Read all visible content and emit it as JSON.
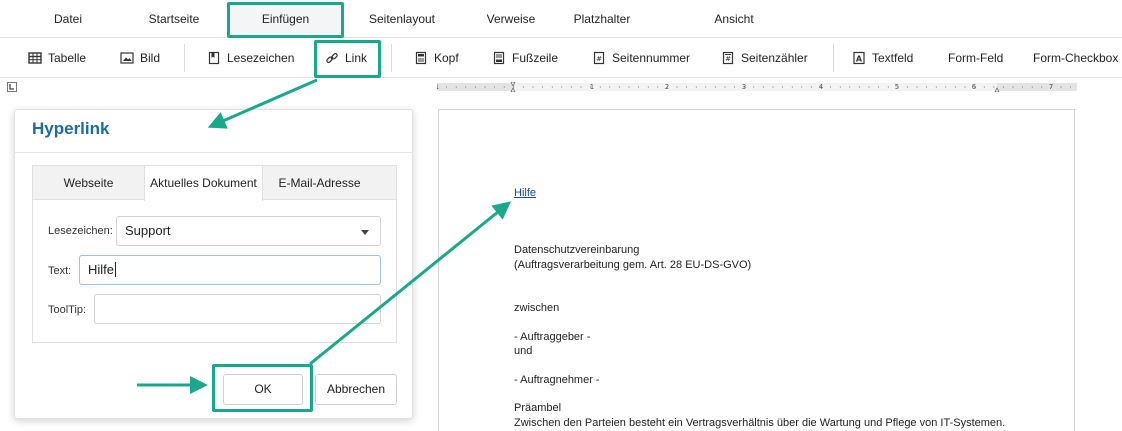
{
  "ribbon": {
    "tabs": [
      {
        "label": "Datei"
      },
      {
        "label": "Startseite"
      },
      {
        "label": "Einfügen"
      },
      {
        "label": "Seitenlayout"
      },
      {
        "label": "Verweise"
      },
      {
        "label": "Platzhalter"
      },
      {
        "label": "Ansicht"
      }
    ],
    "active_tab": "Einfügen"
  },
  "toolbar": {
    "table_label": "Tabelle",
    "image_label": "Bild",
    "bookmark_label": "Lesezeichen",
    "link_label": "Link",
    "header_label": "Kopf",
    "footer_label": "Fußzeile",
    "page_number_label": "Seitennummer",
    "page_count_label": "Seitenzähler",
    "textfield_label": "Textfeld",
    "formfield_label": "Form-Feld",
    "formcheckbox_label": "Form-Checkbox"
  },
  "ruler": {
    "numbers": [
      "1",
      "1",
      "2",
      "3",
      "4",
      "5",
      "6",
      "7"
    ]
  },
  "dialog": {
    "title": "Hyperlink",
    "tabs": [
      "Webseite",
      "Aktuelles Dokument",
      "E-Mail-Adresse"
    ],
    "active_tab": "Aktuelles Dokument",
    "bookmark_label": "Lesezeichen:",
    "bookmark_value": "Support",
    "text_label": "Text:",
    "text_value": "Hilfe",
    "tooltip_label": "ToolTip:",
    "tooltip_value": "",
    "ok_label": "OK",
    "cancel_label": "Abbrechen"
  },
  "document": {
    "link_text": "Hilfe",
    "lines": [
      "Datenschutzvereinbarung",
      "(Auftragsverarbeitung gem. Art. 28 EU-DS-GVO)",
      "zwischen",
      "- Auftraggeber -",
      "und",
      "- Auftragnehmer -",
      "Präambel",
      "Zwischen den Parteien besteht ein Vertragsverhältnis über die Wartung und Pflege von IT-Systemen."
    ]
  },
  "colors": {
    "annotation": "#1aa88a",
    "dialog_title": "#1c6aa8",
    "link": "#1a3fbf"
  }
}
